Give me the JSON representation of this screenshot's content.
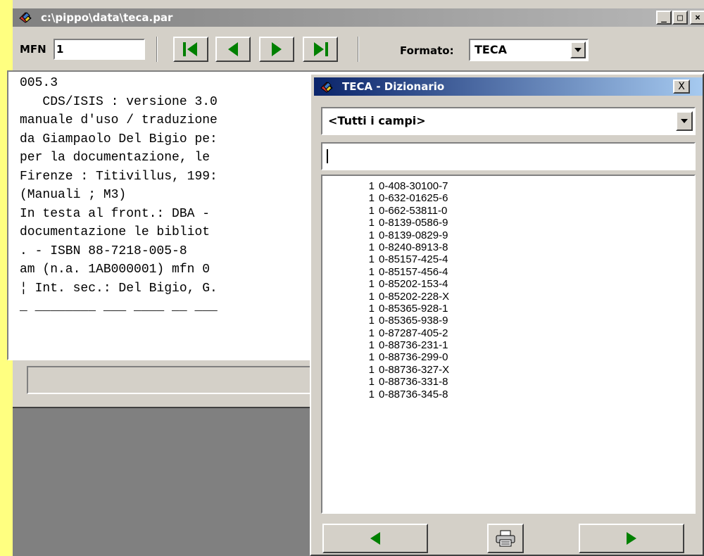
{
  "main_window": {
    "title": "c:\\pippo\\data\\teca.par",
    "mfn_label": "MFN",
    "mfn_value": "1",
    "formato_label": "Formato:",
    "formato_value": "TECA",
    "record_lines": [
      "005.3",
      "   CDS/ISIS : versione 3.0",
      "manuale d'uso / traduzione",
      "da Giampaolo Del Bigio pe:",
      "per la documentazione, le",
      "Firenze : Titivillus, 199:",
      "(Manuali ; M3)",
      "In testa al front.: DBA -",
      "documentazione le bibliot",
      ". - ISBN 88-7218-005-8",
      "am (n.a. 1AB000001) mfn 0",
      "¦ Int. sec.: Del Bigio, G.",
      "_ ________ ___ ____ __ ___"
    ]
  },
  "dictionary": {
    "title": "TECA - Dizionario",
    "close_label": "X",
    "field_selected": "<Tutti i campi>",
    "search_value": "",
    "terms": [
      {
        "count": "1",
        "term": "0-408-30100-7"
      },
      {
        "count": "1",
        "term": "0-632-01625-6"
      },
      {
        "count": "1",
        "term": "0-662-53811-0"
      },
      {
        "count": "1",
        "term": "0-8139-0586-9"
      },
      {
        "count": "1",
        "term": "0-8139-0829-9"
      },
      {
        "count": "1",
        "term": "0-8240-8913-8"
      },
      {
        "count": "1",
        "term": "0-85157-425-4"
      },
      {
        "count": "1",
        "term": "0-85157-456-4"
      },
      {
        "count": "1",
        "term": "0-85202-153-4"
      },
      {
        "count": "1",
        "term": "0-85202-228-X"
      },
      {
        "count": "1",
        "term": "0-85365-928-1"
      },
      {
        "count": "1",
        "term": "0-85365-938-9"
      },
      {
        "count": "1",
        "term": "0-87287-405-2"
      },
      {
        "count": "1",
        "term": "0-88736-231-1"
      },
      {
        "count": "1",
        "term": "0-88736-299-0"
      },
      {
        "count": "1",
        "term": "0-88736-327-X"
      },
      {
        "count": "1",
        "term": "0-88736-331-8"
      },
      {
        "count": "1",
        "term": "0-88736-345-8"
      }
    ]
  },
  "colors": {
    "accent_green": "#008000",
    "active_title": "#0a246a",
    "inactive_title": "#808080",
    "desktop": "#ffff80"
  }
}
